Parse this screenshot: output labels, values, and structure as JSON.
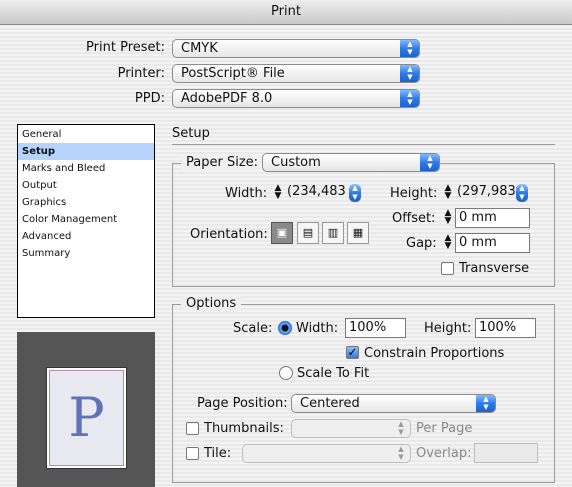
{
  "window": {
    "title": "Print"
  },
  "top": {
    "print_preset_label": "Print Preset:",
    "print_preset_value": "CMYK",
    "printer_label": "Printer:",
    "printer_value": "PostScript® File",
    "ppd_label": "PPD:",
    "ppd_value": "AdobePDF 8.0"
  },
  "sidebar": {
    "items": [
      {
        "label": "General"
      },
      {
        "label": "Setup"
      },
      {
        "label": "Marks and Bleed"
      },
      {
        "label": "Output"
      },
      {
        "label": "Graphics"
      },
      {
        "label": "Color Management"
      },
      {
        "label": "Advanced"
      },
      {
        "label": "Summary"
      }
    ],
    "selected_index": 1
  },
  "preview": {
    "letter": "P"
  },
  "setup": {
    "title": "Setup",
    "paper_size_label": "Paper Size:",
    "paper_size_value": "Custom",
    "width_label": "Width:",
    "width_value": "(234,483",
    "height_label": "Height:",
    "height_value": "(297,983",
    "offset_label": "Offset:",
    "offset_value": "0 mm",
    "gap_label": "Gap:",
    "gap_value": "0 mm",
    "orientation_label": "Orientation:",
    "transverse_label": "Transverse",
    "transverse_checked": false
  },
  "options": {
    "title": "Options",
    "scale_label": "Scale:",
    "width_radio_label": "Width:",
    "width_value": "100%",
    "height_label": "Height:",
    "height_value": "100%",
    "constrain_label": "Constrain Proportions",
    "constrain_checked": true,
    "scale_to_fit_label": "Scale To Fit",
    "page_position_label": "Page Position:",
    "page_position_value": "Centered",
    "thumbnails_label": "Thumbnails:",
    "per_page_label": "Per Page",
    "tile_label": "Tile:",
    "overlap_label": "Overlap:"
  },
  "colors": {
    "accent": "#2e7ae6",
    "selection": "#b5d3fb"
  }
}
